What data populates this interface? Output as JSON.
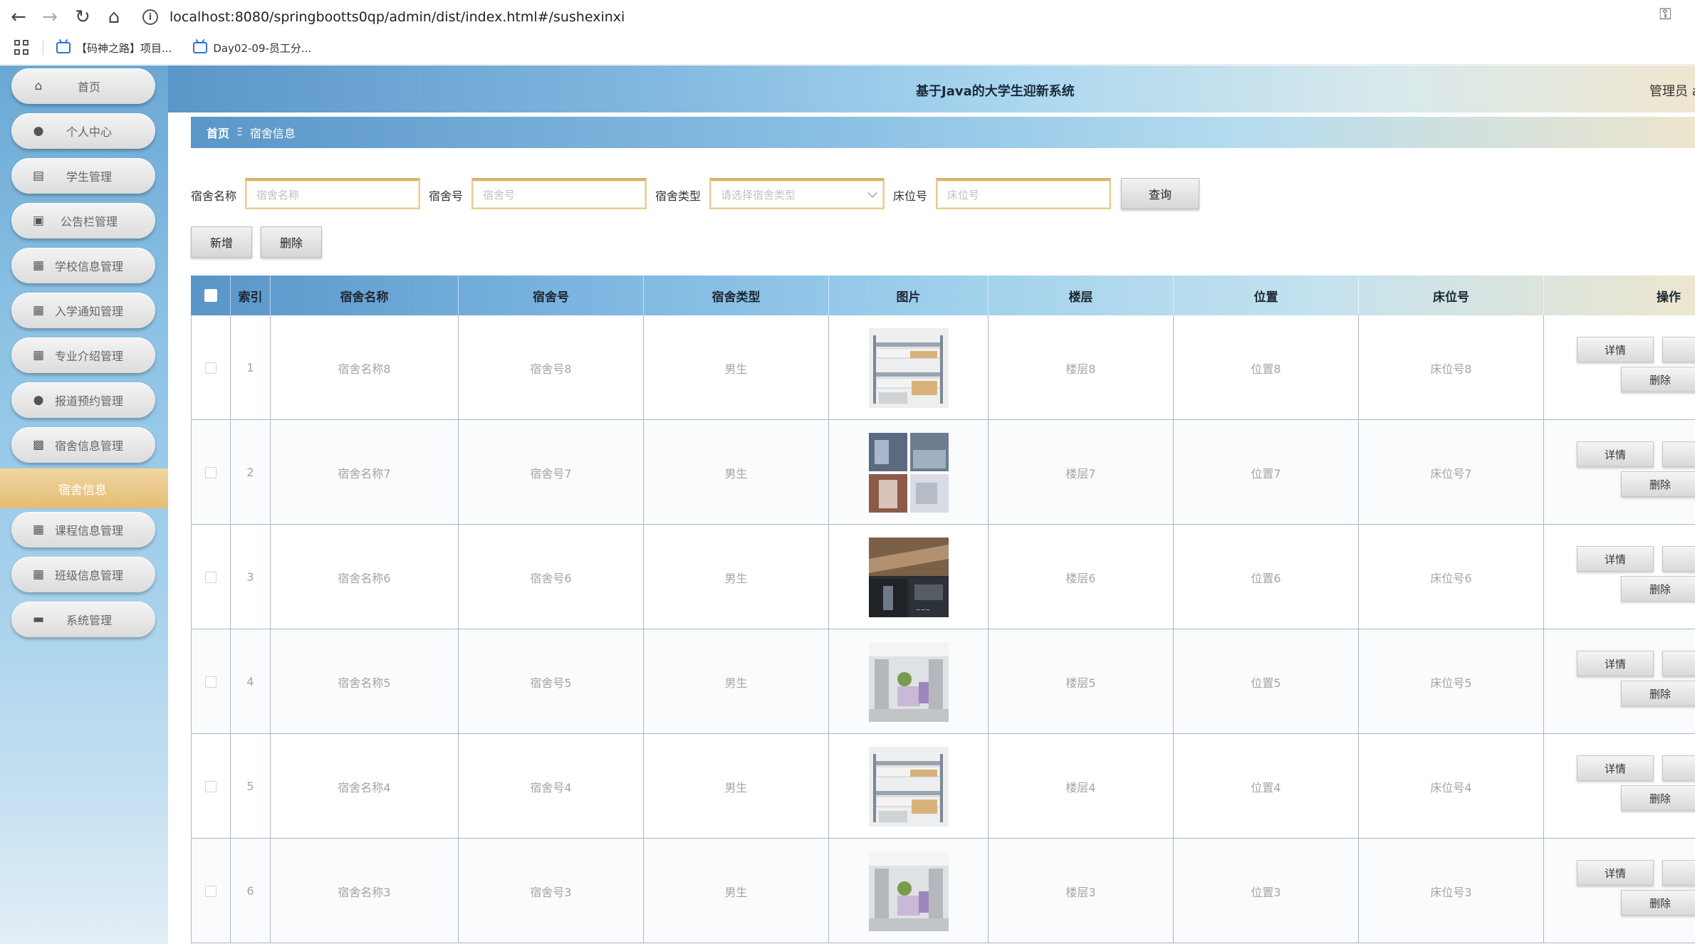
{
  "browser": {
    "url": "localhost:8080/springbootts0qp/admin/dist/index.html#/sushexinxi",
    "bookmarks": [
      "【码神之路】项目...",
      "Day02-09-员工分..."
    ]
  },
  "sidebar": {
    "items": [
      {
        "label": "首页",
        "icon": "home-icon"
      },
      {
        "label": "个人中心",
        "icon": "user-icon"
      },
      {
        "label": "学生管理",
        "icon": "chart-icon"
      },
      {
        "label": "公告栏管理",
        "icon": "monitor-icon"
      },
      {
        "label": "学校信息管理",
        "icon": "grid-icon"
      },
      {
        "label": "入学通知管理",
        "icon": "grid-icon"
      },
      {
        "label": "专业介绍管理",
        "icon": "grid-icon"
      },
      {
        "label": "报道预约管理",
        "icon": "user-icon"
      },
      {
        "label": "宿舍信息管理",
        "icon": "clipboard-icon"
      },
      {
        "label": "课程信息管理",
        "icon": "grid-icon"
      },
      {
        "label": "班级信息管理",
        "icon": "grid-icon"
      },
      {
        "label": "系统管理",
        "icon": "briefcase-icon"
      }
    ],
    "active_sub": "宿舍信息"
  },
  "header": {
    "title": "基于Java的大学生迎新系统",
    "user": "管理员 a"
  },
  "breadcrumb": {
    "home": "首页",
    "separator": "Ξ",
    "current": "宿舍信息"
  },
  "search": {
    "name_label": "宿舍名称",
    "name_placeholder": "宿舍名称",
    "number_label": "宿舍号",
    "number_placeholder": "宿舍号",
    "type_label": "宿舍类型",
    "type_placeholder": "请选择宿舍类型",
    "bed_label": "床位号",
    "bed_placeholder": "床位号",
    "query_button": "查询"
  },
  "toolbar": {
    "add_button": "新增",
    "delete_button": "删除"
  },
  "table": {
    "columns": [
      "索引",
      "宿舍名称",
      "宿舍号",
      "宿舍类型",
      "图片",
      "楼层",
      "位置",
      "床位号",
      "操作"
    ],
    "rows": [
      {
        "index": "1",
        "name": "宿舍名称8",
        "number": "宿舍号8",
        "type": "男生",
        "image": "bunk-bed-photo",
        "floor": "楼层8",
        "location": "位置8",
        "bed": "床位号8"
      },
      {
        "index": "2",
        "name": "宿舍名称7",
        "number": "宿舍号7",
        "type": "男生",
        "image": "room-collage-photo",
        "floor": "楼层7",
        "location": "位置7",
        "bed": "床位号7"
      },
      {
        "index": "3",
        "name": "宿舍名称6",
        "number": "宿舍号6",
        "type": "男生",
        "image": "dark-room-collage-photo",
        "floor": "楼层6",
        "location": "位置6",
        "bed": "床位号6"
      },
      {
        "index": "4",
        "name": "宿舍名称5",
        "number": "宿舍号5",
        "type": "男生",
        "image": "dorm-interior-photo",
        "floor": "楼层5",
        "location": "位置5",
        "bed": "床位号5"
      },
      {
        "index": "5",
        "name": "宿舍名称4",
        "number": "宿舍号4",
        "type": "男生",
        "image": "bunk-bed-photo",
        "floor": "楼层4",
        "location": "位置4",
        "bed": "床位号4"
      },
      {
        "index": "6",
        "name": "宿舍名称3",
        "number": "宿舍号3",
        "type": "男生",
        "image": "dorm-interior-photo",
        "floor": "楼层3",
        "location": "位置3",
        "bed": "床位号3"
      }
    ],
    "row_actions": {
      "detail": "详情",
      "delete": "删除"
    }
  },
  "colors": {
    "accent_gold": "#e4bd75",
    "header_blue": "#5b96c8",
    "row_border": "#a9b7c8"
  }
}
